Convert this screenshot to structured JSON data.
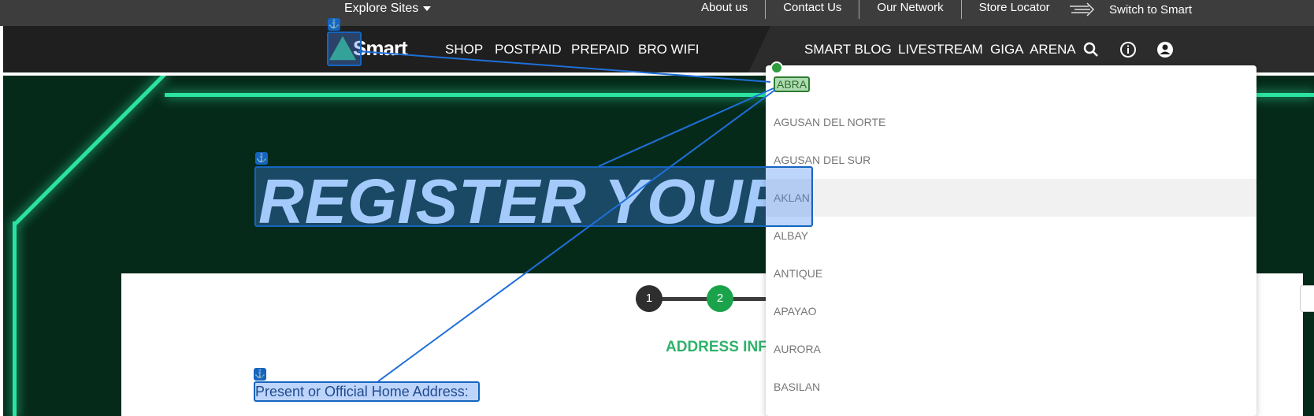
{
  "topbar": {
    "explore_label": "Explore Sites",
    "links": [
      "About us",
      "Contact Us",
      "Our Network",
      "Store Locator"
    ],
    "switch_label": "Switch to Smart"
  },
  "navbar": {
    "logo_text": "Smart",
    "left_items": [
      "SHOP",
      "POSTPAID",
      "PREPAID",
      "BRO WIFI"
    ],
    "right_items": [
      "SMART BLOG",
      "LIVESTREAM",
      "GIGA  ARENA"
    ],
    "icons": [
      "search-icon",
      "info-icon",
      "account-icon"
    ]
  },
  "hero": {
    "title": "REGISTER YOUR SI"
  },
  "steps": [
    "1",
    "2"
  ],
  "form": {
    "section_title": "ADDRESS INF",
    "address_label": "Present or Official Home Address:"
  },
  "dropdown": {
    "options": [
      "ABRA",
      "AGUSAN DEL NORTE",
      "AGUSAN DEL SUR",
      "AKLAN",
      "ALBAY",
      "ANTIQUE",
      "APAYAO",
      "AURORA",
      "BASILAN"
    ],
    "selected": "ABRA",
    "hovered": "AKLAN"
  },
  "colors": {
    "accent_green": "#2fb26b",
    "neon": "#2be3a2",
    "annotation_blue": "#1565c0"
  }
}
